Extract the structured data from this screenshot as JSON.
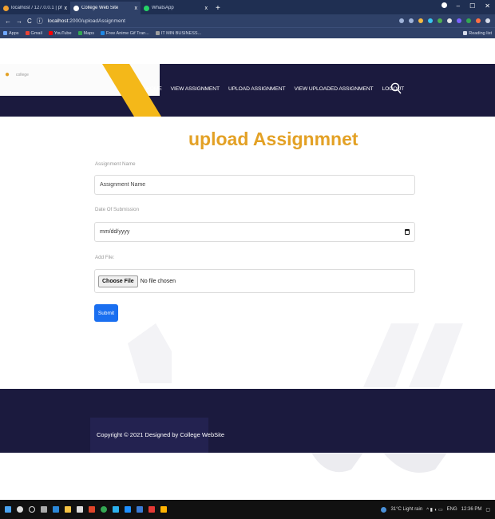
{
  "browser": {
    "tabs": [
      {
        "title": "localhost / 127.0.0.1 | phpMyAdm",
        "fav_color": "#f0a030",
        "active": false
      },
      {
        "title": "College Web Site",
        "fav_color": "#ffffff",
        "active": true
      },
      {
        "title": "WhatsApp",
        "fav_color": "#25d366",
        "active": false
      }
    ],
    "new_tab": "+",
    "nav": {
      "back": "←",
      "forward": "→",
      "reload": "C"
    },
    "url_info": "ⓘ",
    "url_host": "localhost",
    "url_path": ":2000/uploadAssignment",
    "bookmarks": [
      {
        "label": "Apps",
        "color": "#6fa8ff"
      },
      {
        "label": "Gmail",
        "color": "#ea4335"
      },
      {
        "label": "YouTube",
        "color": "#ff0000"
      },
      {
        "label": "Maps",
        "color": "#34a853"
      },
      {
        "label": "Free Anime Gif Tran...",
        "color": "#1e88e5"
      },
      {
        "label": "IT MIN BUSINESS...",
        "color": "#9e9e9e"
      }
    ],
    "reading_list": "Reading list",
    "close_symbol": "x"
  },
  "site": {
    "logo_text": "college",
    "nav": [
      "HOME",
      "VIEW ASSIGNMENT",
      "UPLOAD ASSIGNMENT",
      "VIEW UPLOADED ASSIGNMENT",
      "LOGOUT"
    ],
    "title": "upload Assignmnet",
    "accent_color": "#e3a125",
    "header_color": "#1b1a3e"
  },
  "form": {
    "assignment_name_label": "Assignment Name",
    "assignment_name_placeholder": "Assignment Name",
    "date_label": "Date Of Submission",
    "date_placeholder": "mm/dd/yyyy",
    "file_label": "Add File:",
    "choose_file": "Choose File",
    "no_file": "No file chosen",
    "submit": "Submit"
  },
  "footer": {
    "copyright": "Copyright © 2021 Designed by College WebSite"
  },
  "taskbar": {
    "weather": "31°C Light rain",
    "lang": "ENG",
    "time": "12:36 PM"
  }
}
